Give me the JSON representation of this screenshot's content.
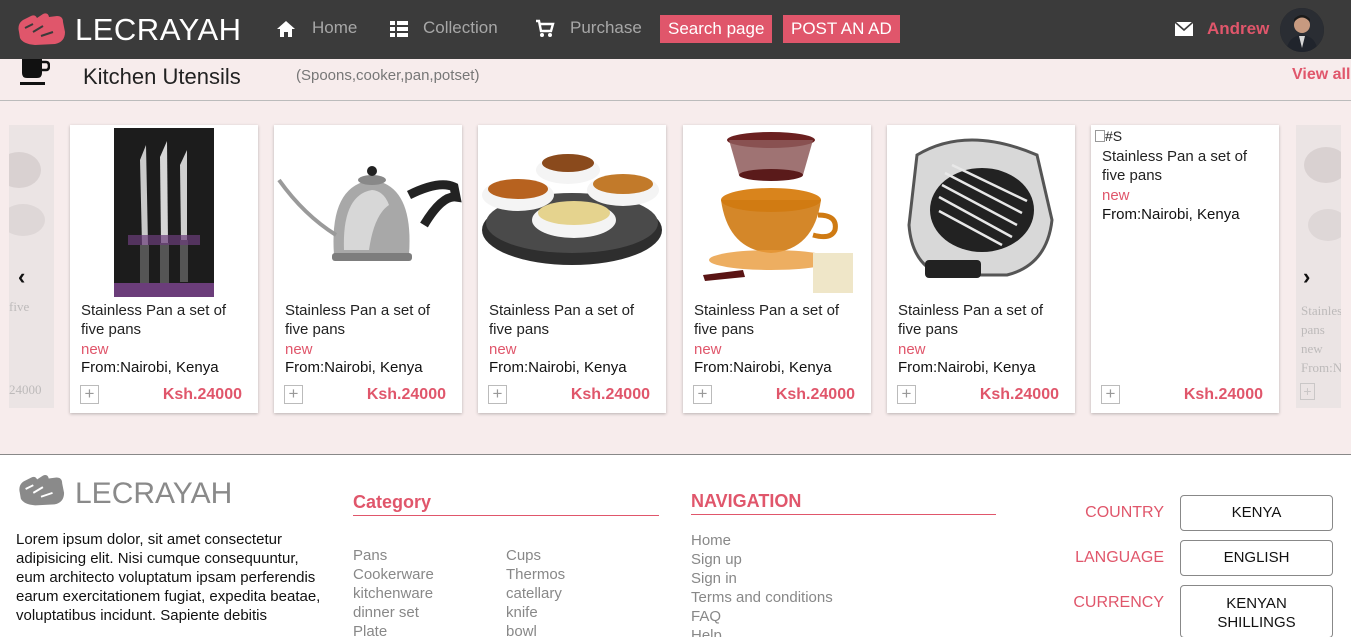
{
  "header": {
    "logo": "LECRAYAH",
    "nav": [
      "Home",
      "Collection",
      "Purchase"
    ],
    "search_button": "Search page",
    "post_button": "POST AN AD",
    "user": "Andrew"
  },
  "section": {
    "title": "Kitchen Utensils",
    "subtitle": "(Spoons,cooker,pan,potset)",
    "view_all": "View all",
    "products": [
      {
        "name": "Stainless Pan a set of five pans",
        "condition": "new",
        "from": "From:Nairobi, Kenya",
        "price": "Ksh.24000"
      },
      {
        "name": "Stainless Pan a set of five pans",
        "condition": "new",
        "from": "From:Nairobi, Kenya",
        "price": "Ksh.24000"
      },
      {
        "name": "Stainless Pan a set of five pans",
        "condition": "new",
        "from": "From:Nairobi, Kenya",
        "price": "Ksh.24000"
      },
      {
        "name": "Stainless Pan a set of five pans",
        "condition": "new",
        "from": "From:Nairobi, Kenya",
        "price": "Ksh.24000"
      },
      {
        "name": "Stainless Pan a set of five pans",
        "condition": "new",
        "from": "From:Nairobi, Kenya",
        "price": "Ksh.24000"
      },
      {
        "name": "Stainless Pan a set of five pans",
        "condition": "new",
        "from": "From:Nairobi, Kenya",
        "price": "Ksh.24000",
        "broken_image_alt": "#S"
      }
    ],
    "ghost_left": {
      "text": "five",
      "price": "24000"
    },
    "ghost_right": {
      "lines": [
        "Stainless",
        "pans",
        "new",
        "From:Na"
      ]
    }
  },
  "footer": {
    "logo": "LECRAYAH",
    "description": "Lorem ipsum dolor, sit amet consectetur adipisicing elit. Nisi cumque consequuntur, eum architecto voluptatum ipsam perferendis earum exercitationem fugiat, expedita beatae, voluptatibus incidunt. Sapiente debitis",
    "category_heading": "Category",
    "category_col1": [
      "Pans",
      "Cookerware",
      "kitchenware",
      "dinner set",
      "Plate"
    ],
    "category_col2": [
      "Cups",
      "Thermos",
      "catellary",
      "knife",
      "bowl"
    ],
    "navigation_heading": "NAVIGATION",
    "navigation": [
      "Home",
      "Sign up",
      "Sign in",
      "Terms and conditions",
      "FAQ",
      "Help"
    ],
    "country_label": "COUNTRY",
    "country_value": "KENYA",
    "language_label": "LANGUAGE",
    "language_value": "ENGLISH",
    "currency_label": "CURRENCY",
    "currency_value": "KENYAN SHILLINGS"
  },
  "colors": {
    "accent": "#e0566b",
    "header_bg": "#3b3b3b",
    "section_bg": "#f7ecec"
  }
}
